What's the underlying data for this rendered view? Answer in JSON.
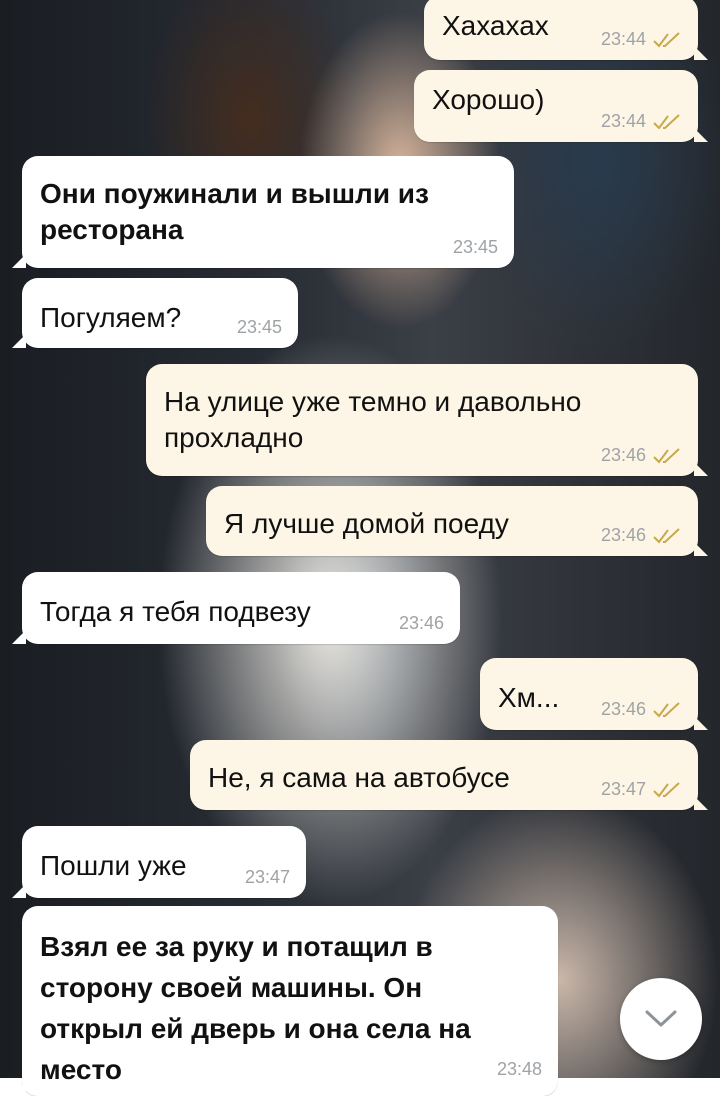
{
  "messages": [
    {
      "direction": "out",
      "text": "Хахахах",
      "time": "23:44",
      "bold": false,
      "read": true
    },
    {
      "direction": "out",
      "text": "Хорошо)",
      "time": "23:44",
      "bold": false,
      "read": true
    },
    {
      "direction": "in",
      "text": "Они поужинали и вышли из ресторана",
      "time": "23:45",
      "bold": true,
      "read": false
    },
    {
      "direction": "in",
      "text": "Погуляем?",
      "time": "23:45",
      "bold": false,
      "read": false
    },
    {
      "direction": "out",
      "text": "На улице уже темно и давольно прохладно",
      "time": "23:46",
      "bold": false,
      "read": true
    },
    {
      "direction": "out",
      "text": "Я лучше домой поеду",
      "time": "23:46",
      "bold": false,
      "read": true
    },
    {
      "direction": "in",
      "text": "Тогда я тебя подвезу",
      "time": "23:46",
      "bold": false,
      "read": false
    },
    {
      "direction": "out",
      "text": "Хм...",
      "time": "23:46",
      "bold": false,
      "read": true
    },
    {
      "direction": "out",
      "text": "Не, я сама на автобусе",
      "time": "23:47",
      "bold": false,
      "read": true
    },
    {
      "direction": "in",
      "text": "Пошли уже",
      "time": "23:47",
      "bold": false,
      "read": false
    },
    {
      "direction": "in",
      "text": "Взял ее за руку и потащил в сторону своей машины. Он открыл ей дверь и она села на место",
      "time": "23:48",
      "bold": true,
      "read": false
    }
  ],
  "colors": {
    "outgoing_bubble": "#fdf6e6",
    "incoming_bubble": "#ffffff",
    "time_text": "#9fa3a6",
    "read_check": "#c9a84a"
  },
  "icons": {
    "read_receipt": "double-check-icon",
    "scroll_down": "chevron-down-icon"
  }
}
